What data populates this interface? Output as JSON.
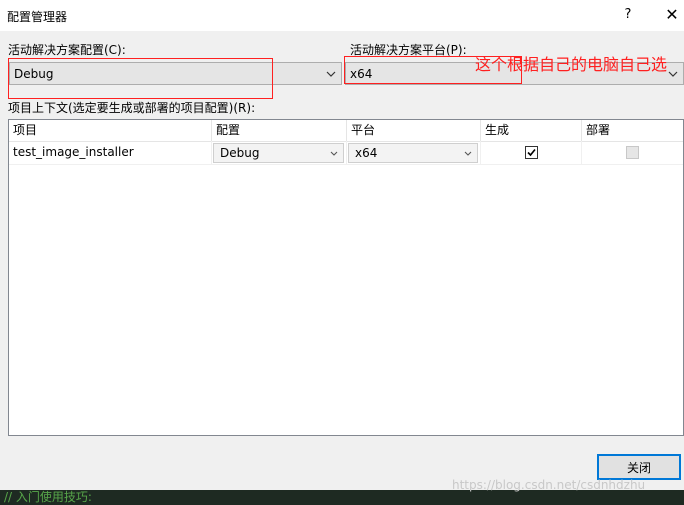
{
  "window": {
    "title": "配置管理器",
    "help_glyph": "?",
    "close_glyph": "✕"
  },
  "active_config": {
    "label": "活动解决方案配置(C):",
    "value": "Debug"
  },
  "active_platform": {
    "label": "活动解决方案平台(P):",
    "value": "x64"
  },
  "annotation": {
    "text": "这个根据自己的电脑自己选",
    "color": "#ff2020"
  },
  "contexts": {
    "label": "项目上下文(选定要生成或部署的项目配置)(R):",
    "columns": [
      "项目",
      "配置",
      "平台",
      "生成",
      "部署"
    ],
    "rows": [
      {
        "project": "test_image_installer",
        "config": "Debug",
        "platform": "x64",
        "build": true,
        "deploy": false
      }
    ]
  },
  "buttons": {
    "close_label": "关闭"
  },
  "background": {
    "code_fragment": "// 入门使用技巧:",
    "watermark": "https://blog.csdn.net/csdnhdzhu"
  },
  "colors": {
    "accent": "#0078d7",
    "annotation": "#ff2020"
  }
}
